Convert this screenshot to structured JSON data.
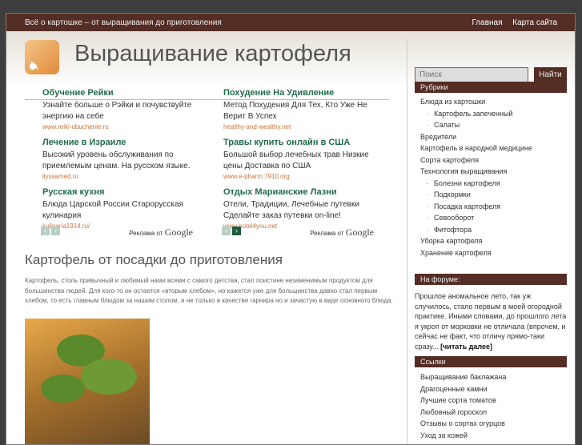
{
  "topbar": {
    "tagline": "Всё о картошке – от выращивания до приготовления",
    "nav": [
      "Главная",
      "Карта сайта"
    ]
  },
  "header": {
    "title": "Выращивание картофеля"
  },
  "search": {
    "placeholder": "Поиск",
    "button": "Найти"
  },
  "ads": [
    [
      {
        "title": "Обучение Рейки",
        "text": "Узнайте больше о Рэйки и почувствуйте энергию на себе",
        "url": "www.reiki-obuchenie.ru"
      },
      {
        "title": "Лечение в Израиле",
        "text": "Высокий уровень обслуживания по приемлемым ценам. На русском языке.",
        "url": "ilyssamed.ru"
      },
      {
        "title": "Русская кухня",
        "text": "Блюда Царской России Старорусская кулинария",
        "url": "kulinaria1914.ru/"
      }
    ],
    [
      {
        "title": "Похудение На Удивление",
        "text": "Метод Похудения Для Тех, Кто Уже Не Верит В Успех",
        "url": "healthy-and-wealthy.net"
      },
      {
        "title": "Травы купить онлайн в США",
        "text": "Большой выбор лечебных трав Низкие цены Доставка по США",
        "url": "www.e-pharm.7910.org"
      },
      {
        "title": "Отдых Марианские Лазни",
        "text": "Отели, Традиции, Лечебные путевки Сделайте заказ путевки on-line!",
        "url": "www.hotel4you.net"
      }
    ]
  ],
  "ad_label": "Реклама от",
  "ad_brand": "Google",
  "article": {
    "title": "Картофель от посадки до приготовления",
    "intro": "Картофель, столь привычный и любимый нами всеми с самого детства, стал поистине незаменимым продуктом для большинства людей. Для кого-то он остается «вторым хлебом», но кажется уже для большинства давно стал первым хлебом, то есть главным блюдом за нашим столом, и не только в качестве гарнира но и зачастую в виде основного блюда."
  },
  "sidebar": {
    "categories_title": "Рубрики",
    "categories": [
      {
        "label": "Блюда из картошки",
        "sub": false
      },
      {
        "label": "Картофель запеченный",
        "sub": true
      },
      {
        "label": "Салаты",
        "sub": true
      },
      {
        "label": "Вредители",
        "sub": false
      },
      {
        "label": "Картофель в народной медицине",
        "sub": false
      },
      {
        "label": "Сорта картофеля",
        "sub": false
      },
      {
        "label": "Технология выращивания",
        "sub": false
      },
      {
        "label": "Болезни картофеля",
        "sub": true
      },
      {
        "label": "Подкормки",
        "sub": true
      },
      {
        "label": "Посадка картофеля",
        "sub": true
      },
      {
        "label": "Севооборот",
        "sub": true
      },
      {
        "label": "Фитофтора",
        "sub": true
      },
      {
        "label": "Уборка картофеля",
        "sub": false
      },
      {
        "label": "Хранение картофеля",
        "sub": false
      }
    ],
    "forum_title": "На форуме:",
    "forum_text": "Прошлое аномальное лето, так уж случилось, стало первым в моей огородной практике. Иными словами, до прошлого лета я укроп от морковки не отличала (впрочем, и сейчас не факт, что отличу прямо-таки сразу...",
    "forum_more": "[читать далее]",
    "links_title": "Ссылки",
    "links": [
      "Выращивание баклажана",
      "Драгоценные камни",
      "Лучшие сорта томатов",
      "Любовный гороскоп",
      "Отзывы о сортах огурцов",
      "Уход за кожей"
    ]
  }
}
